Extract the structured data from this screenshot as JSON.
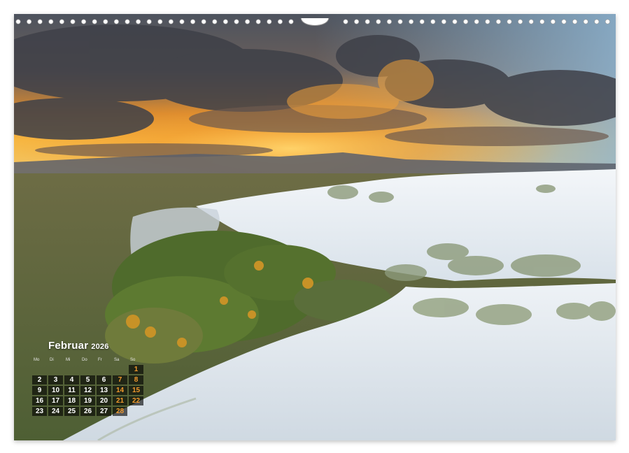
{
  "calendar": {
    "month": "Februar",
    "year": "2026",
    "weekdays": [
      "Mo",
      "Di",
      "Mi",
      "Do",
      "Fr",
      "Sa",
      "So"
    ],
    "days": [
      "",
      "",
      "",
      "",
      "",
      "",
      "1",
      "2",
      "3",
      "4",
      "5",
      "6",
      "7",
      "8",
      "9",
      "10",
      "11",
      "12",
      "13",
      "14",
      "15",
      "16",
      "17",
      "18",
      "19",
      "20",
      "21",
      "22",
      "23",
      "24",
      "25",
      "26",
      "27",
      "28",
      ""
    ]
  },
  "colors": {
    "weekend": "#f29a2e",
    "cell_bg": "#1e1e1e",
    "sky_glow": "#f6a623",
    "sand": "#e8eef3"
  }
}
